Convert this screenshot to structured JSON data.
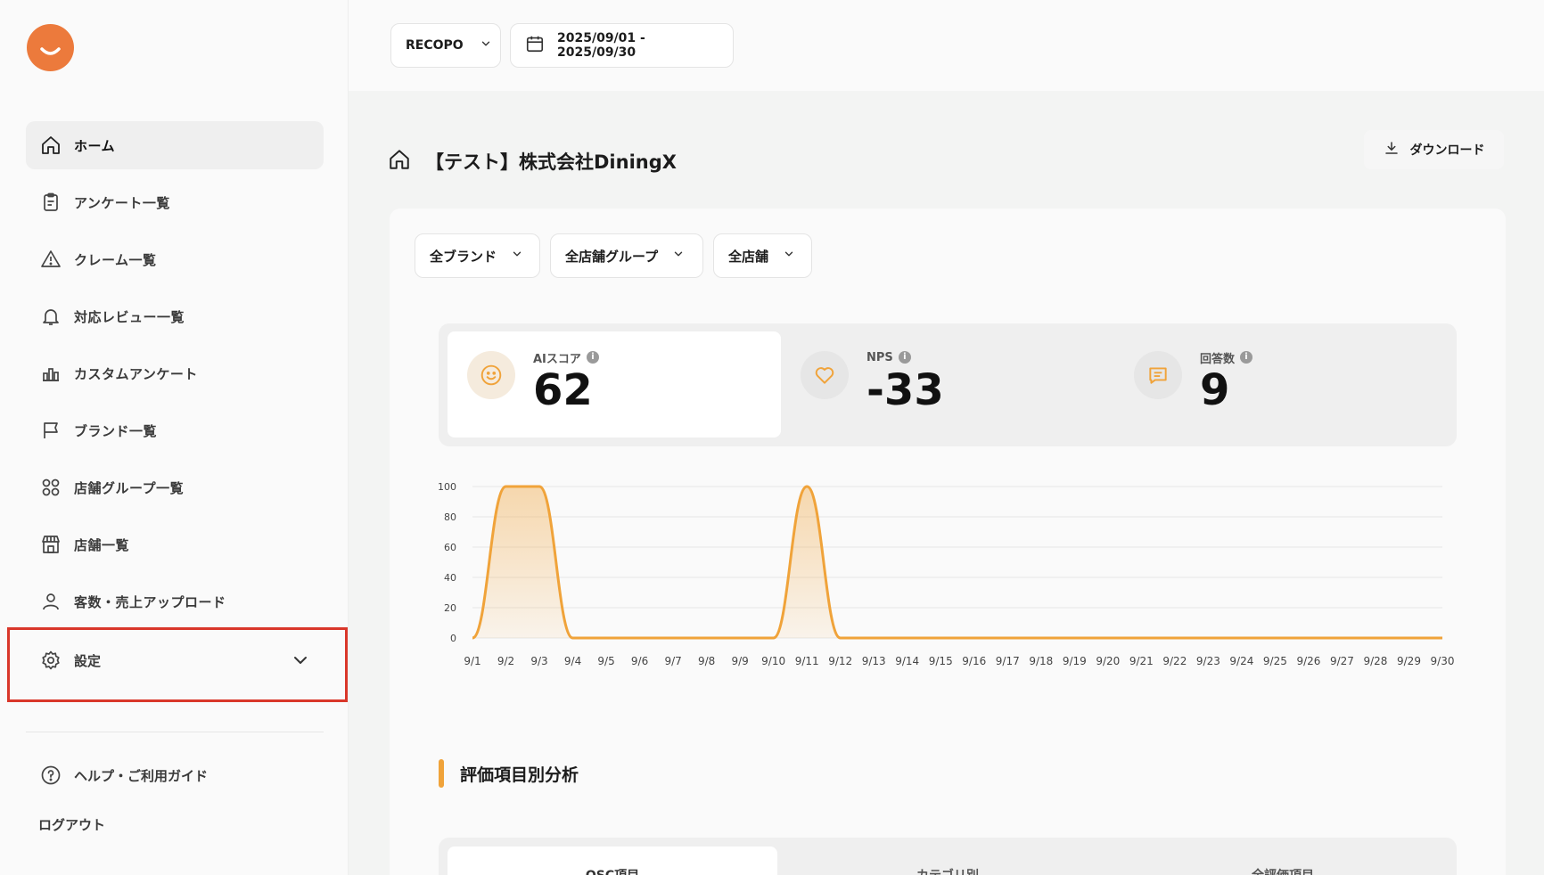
{
  "sidebar": {
    "items": [
      {
        "label": "ホーム",
        "icon": "home-icon"
      },
      {
        "label": "アンケート一覧",
        "icon": "clipboard-icon"
      },
      {
        "label": "クレーム一覧",
        "icon": "warning-icon"
      },
      {
        "label": "対応レビュー一覧",
        "icon": "bell-icon"
      },
      {
        "label": "カスタムアンケート",
        "icon": "bar-chart-icon"
      },
      {
        "label": "ブランド一覧",
        "icon": "flag-icon"
      },
      {
        "label": "店舗グループ一覧",
        "icon": "grid-icon"
      },
      {
        "label": "店舗一覧",
        "icon": "store-icon"
      },
      {
        "label": "客数・売上アップロード",
        "icon": "user-icon"
      }
    ],
    "settings_label": "設定",
    "help_label": "ヘルプ・ご利用ガイド",
    "logout_label": "ログアウト"
  },
  "topbar": {
    "company_select": "RECOPO",
    "date_range": "2025/09/01 - 2025/09/30"
  },
  "page": {
    "title": "【テスト】株式会社DiningX",
    "download_label": "ダウンロード"
  },
  "filters": {
    "brand": "全ブランド",
    "group": "全店舗グループ",
    "store": "全店舗"
  },
  "stats": [
    {
      "name": "AIスコア",
      "value": "62",
      "icon": "smile-icon"
    },
    {
      "name": "NPS",
      "value": "-33",
      "icon": "heart-icon"
    },
    {
      "name": "回答数",
      "value": "9",
      "icon": "message-icon"
    }
  ],
  "chart_data": {
    "type": "area",
    "x": [
      "9/1",
      "9/2",
      "9/3",
      "9/4",
      "9/5",
      "9/6",
      "9/7",
      "9/8",
      "9/9",
      "9/10",
      "9/11",
      "9/12",
      "9/13",
      "9/14",
      "9/15",
      "9/16",
      "9/17",
      "9/18",
      "9/19",
      "9/20",
      "9/21",
      "9/22",
      "9/23",
      "9/24",
      "9/25",
      "9/26",
      "9/27",
      "9/28",
      "9/29",
      "9/30"
    ],
    "values": [
      0,
      100,
      100,
      0,
      0,
      0,
      0,
      0,
      0,
      0,
      100,
      0,
      0,
      0,
      0,
      0,
      0,
      0,
      0,
      0,
      0,
      0,
      0,
      0,
      0,
      0,
      0,
      0,
      0,
      0
    ],
    "yticks": [
      "0",
      "20",
      "40",
      "60",
      "80",
      "100"
    ],
    "ylim": [
      0,
      100
    ],
    "grid": true,
    "color": "#f0a33a"
  },
  "section": {
    "title": "評価項目別分析",
    "tabs": [
      "OSC項目",
      "カテゴリ別",
      "全評価項目"
    ]
  },
  "colors": {
    "accent": "#f0a33a",
    "brand": "#ec7a3c",
    "highlight_box": "#d9372a"
  }
}
